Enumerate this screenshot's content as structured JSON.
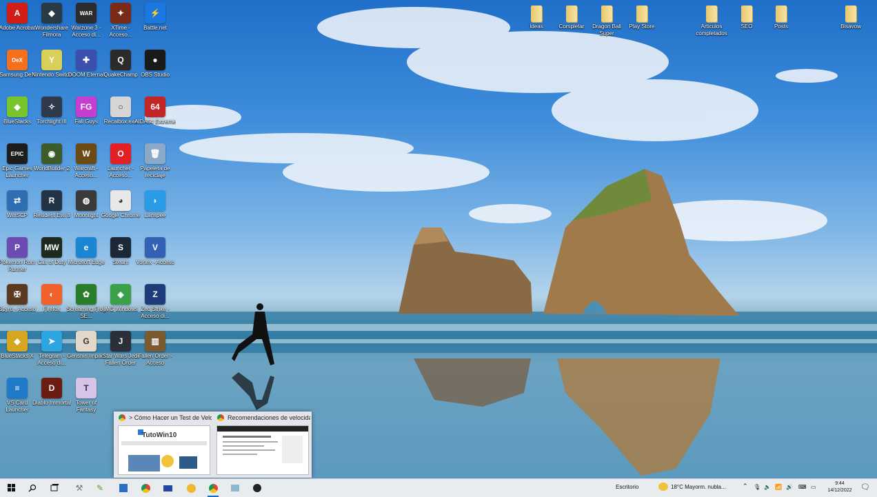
{
  "desktop": {
    "icons": [
      {
        "id": "adobe",
        "label": "Adobe Acrobat",
        "glyph": "A",
        "color": "#d21d16"
      },
      {
        "id": "wondershare",
        "label": "Wondershare Filmora",
        "glyph": "◆",
        "color": "#2a3b48"
      },
      {
        "id": "war3",
        "label": "Warzone 3 - Acceso di...",
        "glyph": "WAR",
        "color": "#2c2c2c"
      },
      {
        "id": "xfinal",
        "label": "XTime - Acceso...",
        "glyph": "✦",
        "color": "#7a2b18"
      },
      {
        "id": "battlenet",
        "label": "Battle.net",
        "glyph": "⚡",
        "color": "#1a78e0"
      },
      {
        "id": "dex",
        "label": "Samsung DeX",
        "glyph": "DeX",
        "color": "#f4701e"
      },
      {
        "id": "switch",
        "label": "Nintendo Switch",
        "glyph": "Y",
        "color": "#d9d05a"
      },
      {
        "id": "dbz",
        "label": "DOOM Eternal",
        "glyph": "✚",
        "color": "#3c4fae"
      },
      {
        "id": "quake",
        "label": "QuakeChamp",
        "glyph": "Q",
        "color": "#2b2b2b"
      },
      {
        "id": "obs",
        "label": "OBS Studio",
        "glyph": "●",
        "color": "#1a1a1a"
      },
      {
        "id": "bluestacks",
        "label": "BlueStacks",
        "glyph": "◆",
        "color": "#77c52e"
      },
      {
        "id": "torchlight",
        "label": "Torchlight III",
        "glyph": "✧",
        "color": "#2f3b4c"
      },
      {
        "id": "fallguys",
        "label": "Fall Guys",
        "glyph": "FG",
        "color": "#c43ecf"
      },
      {
        "id": "recycle",
        "label": "Recalbox.exe",
        "glyph": "○",
        "color": "#d5d5d5"
      },
      {
        "id": "aida64",
        "label": "AIDA64 Extreme",
        "glyph": "64",
        "color": "#c32626"
      },
      {
        "id": "epic",
        "label": "Epic Games Launcher",
        "glyph": "EPIC",
        "color": "#1d1d1d"
      },
      {
        "id": "wow",
        "label": "WorldBuilder 2",
        "glyph": "◉",
        "color": "#3d5c2c"
      },
      {
        "id": "warcraft",
        "label": "Warcraft - Acceso...",
        "glyph": "W",
        "color": "#6b4a13"
      },
      {
        "id": "opera",
        "label": "Launcher - Acceso...",
        "glyph": "O",
        "color": "#e32026"
      },
      {
        "id": "bin",
        "label": "Papelera de reciclaje",
        "glyph": "🗑",
        "color": "#8aa9c8"
      },
      {
        "id": "winscp",
        "label": "WinSCP",
        "glyph": "⇄",
        "color": "#2f6fb1"
      },
      {
        "id": "resident",
        "label": "Resident Evil 8",
        "glyph": "R",
        "color": "#243447"
      },
      {
        "id": "moonlight",
        "label": "Moonlight",
        "glyph": "◍",
        "color": "#3a3a3a"
      },
      {
        "id": "chrome",
        "label": "Google Chrome",
        "glyph": "◕",
        "color": "#e8e8e8"
      },
      {
        "id": "lanspee",
        "label": "Lanspee",
        "glyph": "◗",
        "color": "#2a9be6"
      },
      {
        "id": "pokemon",
        "label": "Pokemon Rom Runner",
        "glyph": "P",
        "color": "#6c4bb3"
      },
      {
        "id": "mw",
        "label": "Call of Duty",
        "glyph": "MW",
        "color": "#1f2a1f"
      },
      {
        "id": "edge",
        "label": "Microsoft Edge",
        "glyph": "e",
        "color": "#1b86d3"
      },
      {
        "id": "steam",
        "label": "Steam",
        "glyph": "S",
        "color": "#1b2838"
      },
      {
        "id": "vray",
        "label": "Vortex - Acceso",
        "glyph": "V",
        "color": "#3561b5"
      },
      {
        "id": "spyro",
        "label": "Spyro - Acceso",
        "glyph": "✠",
        "color": "#5b3a22"
      },
      {
        "id": "firefox",
        "label": "Firefox",
        "glyph": "◐",
        "color": "#f0612b"
      },
      {
        "id": "cleaner",
        "label": "Screaming Frog SE...",
        "glyph": "✿",
        "color": "#2a7d2a"
      },
      {
        "id": "mcafee",
        "label": "IMG Windows",
        "glyph": "◈",
        "color": "#3aa04a"
      },
      {
        "id": "zed",
        "label": "Zed Strike - Acceso di...",
        "glyph": "Z",
        "color": "#1e3b7a"
      },
      {
        "id": "bluestacks2",
        "label": "BlueStacks X",
        "glyph": "◆",
        "color": "#d6a620"
      },
      {
        "id": "telegram",
        "label": "Telegram - Acceso di...",
        "glyph": "➤",
        "color": "#2ca5e0"
      },
      {
        "id": "genshin",
        "label": "Genshin Impact",
        "glyph": "G",
        "color": "#e3d8c8"
      },
      {
        "id": "starwars",
        "label": "Star Wars Jedi Fallen Order",
        "glyph": "J",
        "color": "#2b2f3a"
      },
      {
        "id": "books",
        "label": "Fallen Order - Acceso",
        "glyph": "▥",
        "color": "#7b5a2f"
      },
      {
        "id": "vscard",
        "label": "VS Card Launcher",
        "glyph": "≡",
        "color": "#1f7ac9"
      },
      {
        "id": "diablo",
        "label": "Diablo Immortal",
        "glyph": "D",
        "color": "#6b1d12"
      },
      {
        "id": "tower",
        "label": "Tower of Fantasy",
        "glyph": "T",
        "color": "#d7c3e8"
      }
    ],
    "folders": [
      {
        "label": "Ideas"
      },
      {
        "label": "Completar"
      },
      {
        "label": "Dragon Ball Super"
      },
      {
        "label": "Play Store"
      },
      {
        "label": "Articulos completados"
      },
      {
        "label": "SEO"
      },
      {
        "label": "Posts"
      },
      {
        "label": "Bisavow"
      }
    ]
  },
  "thumbnails": [
    {
      "title": "> Cómo Hacer un Test de Velo...",
      "logo": "TutoWin10"
    },
    {
      "title": "Recomendaciones de velocida..."
    }
  ],
  "taskbar": {
    "apps": [
      "start-icon",
      "search-icon",
      "task-view-icon",
      "tools-icon",
      "pen-icon",
      "store-icon",
      "chrome-icon",
      "monitor-icon",
      "folder-icon",
      "chrome-active-icon",
      "app-icon",
      "obs-icon"
    ],
    "desktop_label": "Escritorio",
    "weather": "18°C  Mayorm. nubla...",
    "time": "9:44",
    "date": "14/12/2022"
  }
}
